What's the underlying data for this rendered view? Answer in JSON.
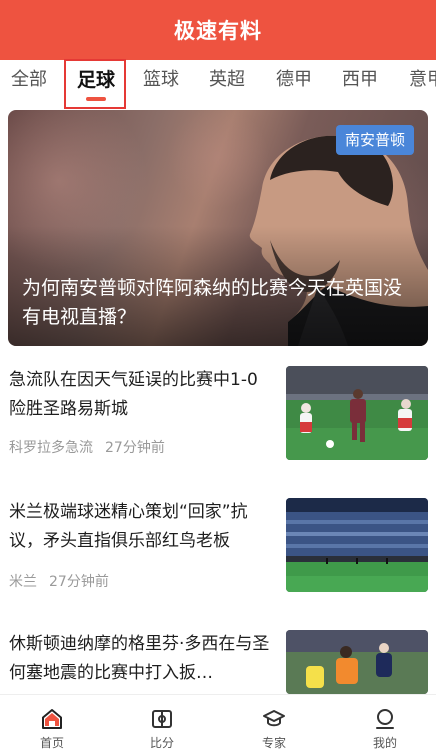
{
  "header": {
    "title": "极速有料"
  },
  "tabs": [
    {
      "label": "全部"
    },
    {
      "label": "足球"
    },
    {
      "label": "篮球"
    },
    {
      "label": "英超"
    },
    {
      "label": "德甲"
    },
    {
      "label": "西甲"
    },
    {
      "label": "意甲"
    }
  ],
  "active_tab": "足球",
  "hero": {
    "badge": "南安普顿",
    "title": "为何南安普顿对阵阿森纳的比赛今天在英国没有电视直播？"
  },
  "news": [
    {
      "title": "急流队在因天气延误的比赛中1-0险胜圣路易斯城",
      "source": "科罗拉多急流",
      "time": "27分钟前"
    },
    {
      "title": "米兰极端球迷精心策划“回家”抗议，矛头直指俱乐部红鸟老板",
      "source": "米兰",
      "time": "27分钟前"
    },
    {
      "title": "休斯顿迪纳摩的格里芬·多西在与圣何塞地震的比赛中打入扳…"
    }
  ],
  "bottom_nav": [
    {
      "label": "首页",
      "icon": "home-icon"
    },
    {
      "label": "比分",
      "icon": "scoreboard-icon"
    },
    {
      "label": "专家",
      "icon": "mortarboard-icon"
    },
    {
      "label": "我的",
      "icon": "profile-icon"
    }
  ],
  "colors": {
    "brand": "#ee5340",
    "badge": "#4a86d9",
    "meta_text": "#9a9a9a"
  }
}
